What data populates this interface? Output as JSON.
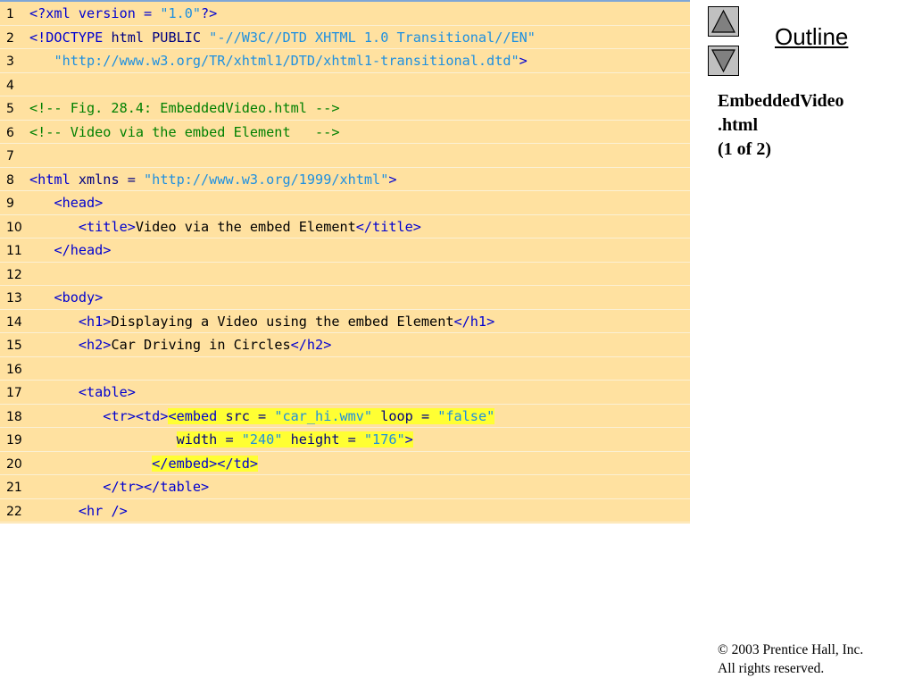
{
  "code_lines": [
    {
      "num": "1",
      "segments": [
        [
          "tag",
          "<?xml version = "
        ],
        [
          "str",
          "\"1.0\""
        ],
        [
          "tag",
          "?>"
        ]
      ]
    },
    {
      "num": "2",
      "segments": [
        [
          "tag",
          "<!DOCTYPE "
        ],
        [
          "attr",
          "html PUBLIC "
        ],
        [
          "str",
          "\"-//W3C//DTD XHTML 1.0 Transitional//EN\""
        ]
      ]
    },
    {
      "num": "3",
      "segments": [
        [
          "txt",
          "   "
        ],
        [
          "str",
          "\"http://www.w3.org/TR/xhtml1/DTD/xhtml1-transitional.dtd\""
        ],
        [
          "tag",
          ">"
        ]
      ]
    },
    {
      "num": "4",
      "segments": []
    },
    {
      "num": "5",
      "segments": [
        [
          "cmt",
          "<!-- Fig. 28.4: EmbeddedVideo.html -->"
        ]
      ]
    },
    {
      "num": "6",
      "segments": [
        [
          "cmt",
          "<!-- Video via the embed Element   -->"
        ]
      ]
    },
    {
      "num": "7",
      "segments": []
    },
    {
      "num": "8",
      "segments": [
        [
          "tag",
          "<html "
        ],
        [
          "attr",
          "xmlns = "
        ],
        [
          "str",
          "\"http://www.w3.org/1999/xhtml\""
        ],
        [
          "tag",
          ">"
        ]
      ]
    },
    {
      "num": "9",
      "segments": [
        [
          "txt",
          "   "
        ],
        [
          "tag",
          "<head>"
        ]
      ]
    },
    {
      "num": "10",
      "segments": [
        [
          "txt",
          "      "
        ],
        [
          "tag",
          "<title>"
        ],
        [
          "txt",
          "Video via the embed Element"
        ],
        [
          "tag",
          "</title>"
        ]
      ]
    },
    {
      "num": "11",
      "segments": [
        [
          "txt",
          "   "
        ],
        [
          "tag",
          "</head>"
        ]
      ]
    },
    {
      "num": "12",
      "segments": []
    },
    {
      "num": "13",
      "segments": [
        [
          "txt",
          "   "
        ],
        [
          "tag",
          "<body>"
        ]
      ]
    },
    {
      "num": "14",
      "segments": [
        [
          "txt",
          "      "
        ],
        [
          "tag",
          "<h1>"
        ],
        [
          "txt",
          "Displaying a Video using the embed Element"
        ],
        [
          "tag",
          "</h1>"
        ]
      ]
    },
    {
      "num": "15",
      "segments": [
        [
          "txt",
          "      "
        ],
        [
          "tag",
          "<h2>"
        ],
        [
          "txt",
          "Car Driving in Circles"
        ],
        [
          "tag",
          "</h2>"
        ]
      ]
    },
    {
      "num": "16",
      "segments": []
    },
    {
      "num": "17",
      "segments": [
        [
          "txt",
          "      "
        ],
        [
          "tag",
          "<table>"
        ]
      ]
    },
    {
      "num": "18",
      "segments": [
        [
          "txt",
          "         "
        ],
        [
          "tag",
          "<tr><td>"
        ],
        [
          "hltag",
          "<embed "
        ],
        [
          "hlattr",
          "src = "
        ],
        [
          "hlstr",
          "\"car_hi.wmv\""
        ],
        [
          "hlattr",
          " loop = "
        ],
        [
          "hlstr",
          "\"false\""
        ]
      ]
    },
    {
      "num": "19",
      "segments": [
        [
          "txt",
          "                  "
        ],
        [
          "hlattr",
          "width = "
        ],
        [
          "hlstr",
          "\"240\""
        ],
        [
          "hlattr",
          " height = "
        ],
        [
          "hlstr",
          "\"176\""
        ],
        [
          "hltag",
          ">"
        ]
      ]
    },
    {
      "num": "20",
      "segments": [
        [
          "txt",
          "               "
        ],
        [
          "hltag",
          "</embed></td>"
        ]
      ]
    },
    {
      "num": "21",
      "segments": [
        [
          "txt",
          "         "
        ],
        [
          "tag",
          "</tr></table>"
        ]
      ]
    },
    {
      "num": "22",
      "segments": [
        [
          "txt",
          "      "
        ],
        [
          "tag",
          "<hr />"
        ]
      ]
    }
  ],
  "nav": {
    "outline_label": "Outline",
    "up_icon": "triangle-up-icon",
    "down_icon": "triangle-down-icon"
  },
  "slide": {
    "title_line1": "EmbeddedVideo",
    "title_line2": ".html",
    "title_line3": "(1 of 2)"
  },
  "footer": {
    "copyright_line1": "© 2003 Prentice Hall, Inc.",
    "copyright_line2": "All rights reserved."
  },
  "colors": {
    "panel_bg": "#ffe1a0",
    "tag": "#0000d0",
    "string": "#1e90e0",
    "comment": "#008000",
    "highlight": "#ffff33"
  }
}
